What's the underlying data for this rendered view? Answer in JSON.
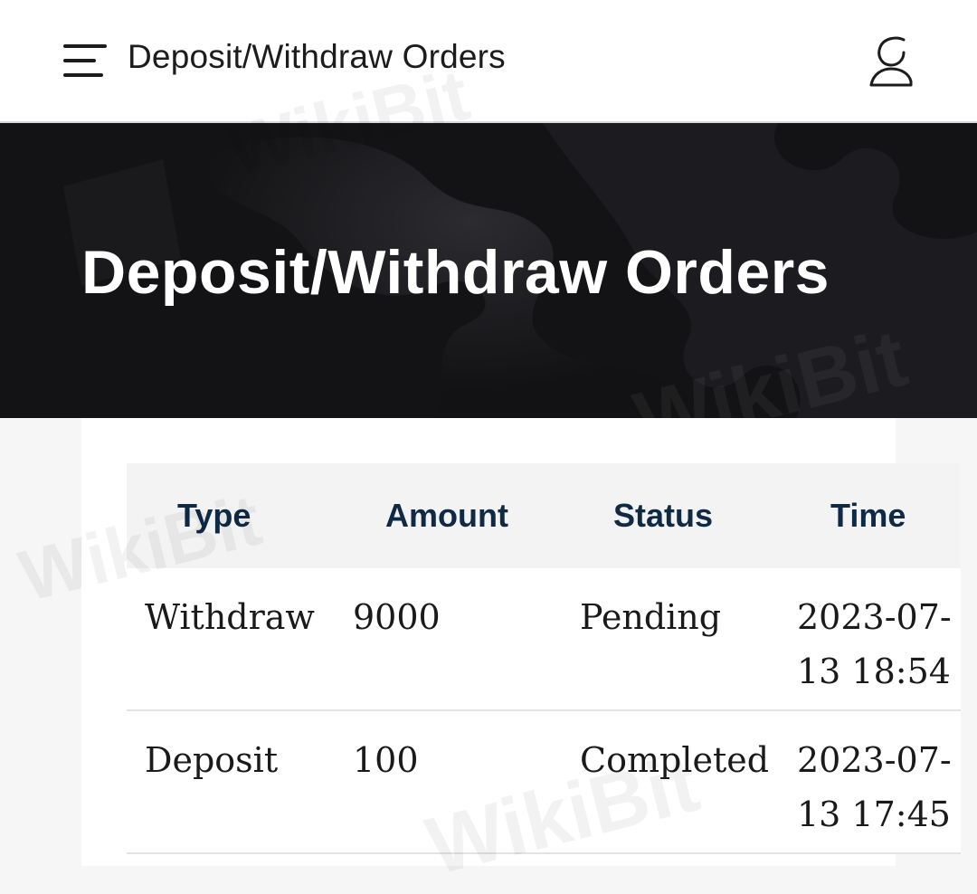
{
  "header": {
    "title": "Deposit/Withdraw Orders",
    "menu_icon": "hamburger-menu-icon",
    "user_icon": "user-profile-icon"
  },
  "hero": {
    "title": "Deposit/Withdraw Orders"
  },
  "orders_table": {
    "columns": [
      "Type",
      "Amount",
      "Status",
      "Time"
    ],
    "rows": [
      {
        "type": "Withdraw",
        "amount": "9000",
        "status": "Pending",
        "time": "2023-07-13 18:54"
      },
      {
        "type": "Deposit",
        "amount": "100",
        "status": "Completed",
        "time": "2023-07-13 17:45"
      }
    ]
  },
  "watermark": "WikiBit",
  "colors": {
    "hero_background": "#121214",
    "header_text": "#0f2a44",
    "page_background": "#f6f6f7"
  }
}
